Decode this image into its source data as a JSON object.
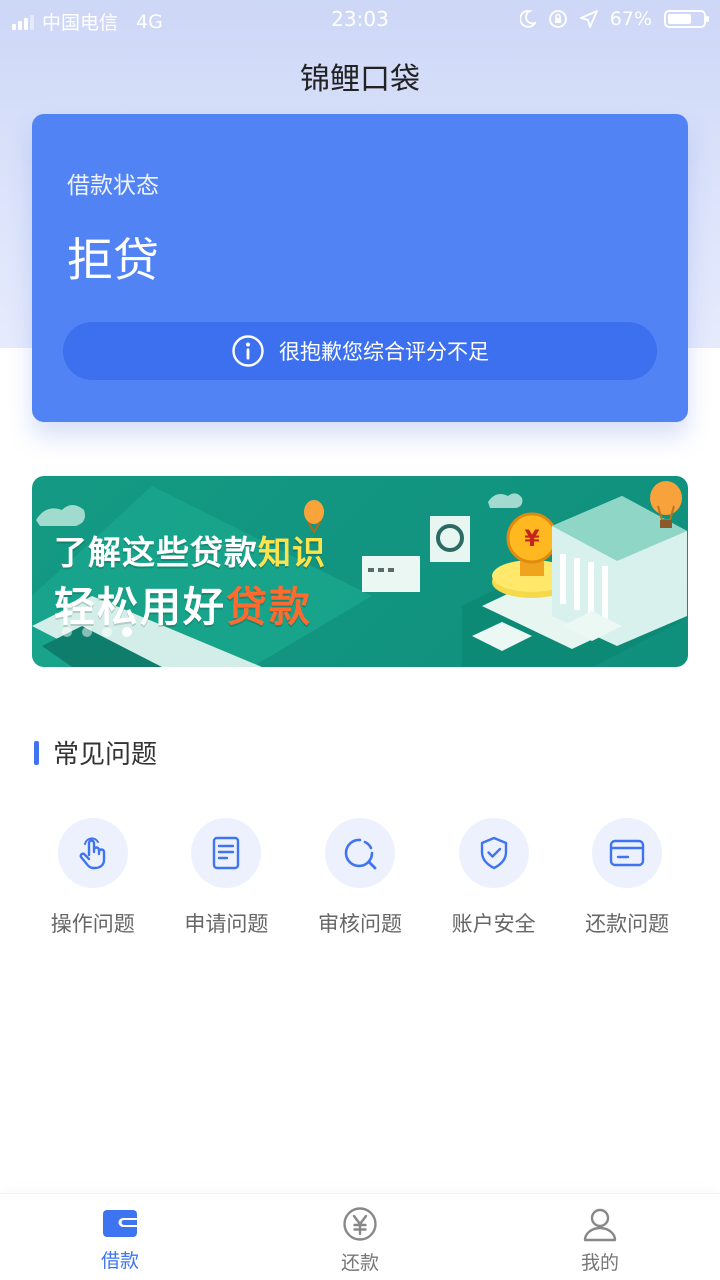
{
  "status_bar": {
    "carrier": "中国电信",
    "network": "4G",
    "time": "23:03",
    "battery_text": "67%",
    "battery_level": 0.67
  },
  "header": {
    "title": "锦鲤口袋"
  },
  "loan_status": {
    "label": "借款状态",
    "value": "拒贷",
    "reason": "很抱歉您综合评分不足"
  },
  "banner": {
    "line1_prefix": "了解这些贷款",
    "line1_highlight": "知识",
    "line2_prefix": "轻松用好",
    "line2_highlight": "贷款",
    "slide_count": 4,
    "active_slide": 4
  },
  "faq": {
    "title": "常见问题",
    "items": [
      {
        "label": "操作问题",
        "icon": "tap-hand-icon"
      },
      {
        "label": "申请问题",
        "icon": "document-icon"
      },
      {
        "label": "审核问题",
        "icon": "review-search-icon"
      },
      {
        "label": "账户安全",
        "icon": "shield-check-icon"
      },
      {
        "label": "还款问题",
        "icon": "card-icon"
      }
    ]
  },
  "tabbar": {
    "tabs": [
      {
        "label": "借款",
        "icon": "wallet-icon",
        "active": true
      },
      {
        "label": "还款",
        "icon": "yen-coin-icon",
        "active": false
      },
      {
        "label": "我的",
        "icon": "user-icon",
        "active": false
      }
    ]
  },
  "colors": {
    "primary": "#3f74f0",
    "card": "#5183f5",
    "pill": "#3d70ef",
    "banner_green": "#149a84",
    "highlight_yellow": "#ffe34d",
    "highlight_orange": "#ff6a2e"
  }
}
